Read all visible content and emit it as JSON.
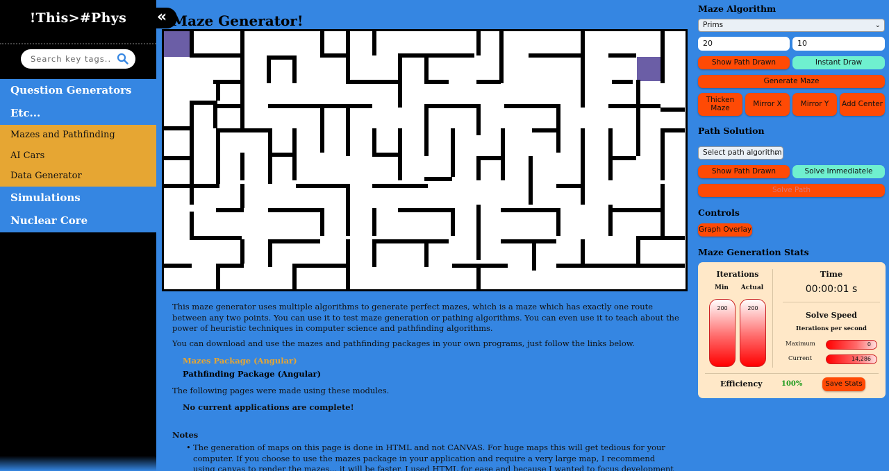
{
  "sidebar": {
    "brand": "!This>#Phys",
    "search_placeholder": "Search key tags...",
    "collapse_label": "«",
    "categories": [
      {
        "label": "Question Generators"
      },
      {
        "label": "Etc..."
      },
      {
        "label": "Simulations"
      },
      {
        "label": "Nuclear Core"
      }
    ],
    "sub_items": [
      {
        "label": "Mazes and Pathfinding"
      },
      {
        "label": "AI Cars"
      },
      {
        "label": "Data Generator"
      }
    ]
  },
  "main": {
    "title": "Maze Generator!",
    "paragraph1": "This maze generator uses multiple algorithms to generate perfect mazes, which is a maze which has exactly one route between any two points. You can use it to test maze generation or pathing algorithms. You can even use it to teach about the power of heuristic techniques in computer science and pathfinding algorithms.",
    "paragraph2": "You can download and use the mazes and pathfinding packages in your own programs, just follow the links below.",
    "link_mazes": "Mazes Package (Angular)",
    "link_pathfinding": "Pathfinding Package (Angular)",
    "paragraph3": "The following pages were made using these modules.",
    "no_apps": "No current applications are complete!",
    "notes_title": "Notes",
    "note1": "The generation of maps on this page is done in HTML and not CANVAS. For huge maps this will get tedious for your computer. If you choose to use the mazes package in your application and require a very large map, I recommend using canvas to render the mazes... it will be faster. I used HTML for ease and because I wanted to focus development on the algorithms and not the display."
  },
  "panel": {
    "maze_algorithm_title": "Maze Algorithm",
    "algorithm_selected": "Prims",
    "width_value": "20",
    "height_value": "10",
    "show_path_drawn": "Show Path Drawn",
    "instant_draw": "Instant Draw",
    "generate_maze": "Generate Maze",
    "thicken_maze": "Thicken Maze",
    "mirror_x": "Mirror X",
    "mirror_y": "Mirror Y",
    "add_center": "Add Center",
    "path_solution_title": "Path Solution",
    "path_algorithm_placeholder": "Select path algorithm",
    "show_path_drawn_2": "Show Path Drawn",
    "solve_immediately": "Solve Immediatele",
    "solve_path": "Solve Path",
    "controls_title": "Controls",
    "graph_overlay": "Graph Overlay",
    "stats_title": "Maze Generation Stats"
  },
  "stats": {
    "iterations_label": "Iterations",
    "min_label": "Min",
    "actual_label": "Actual",
    "min_value": "200",
    "actual_value": "200",
    "time_label": "Time",
    "time_value": "00:00:01 s",
    "solve_speed_label": "Solve Speed",
    "ips_label": "Iterations per second",
    "maximum_label": "Maximum",
    "maximum_value": "0",
    "current_label": "Current",
    "current_value": "14,286",
    "efficiency_label": "Efficiency",
    "efficiency_value": "100%",
    "save_stats": "Save Stats"
  },
  "colors": {
    "background": "#3586e2",
    "accent_orange": "#e6a633",
    "button_red": "#ff4a05",
    "button_teal": "#6ff0cf",
    "maze_marker": "#6b5ea6"
  }
}
